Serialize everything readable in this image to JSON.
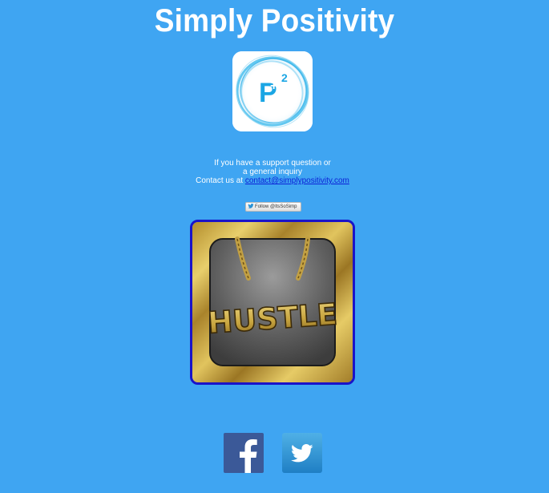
{
  "header": {
    "title": "Simply Positivity"
  },
  "logo": {
    "glyph": "P",
    "plus": "+",
    "superscript": "2",
    "accent_color": "#1ba6e4"
  },
  "support": {
    "line1": "If you have a support question or",
    "line2": "a general inquiry",
    "line3_prefix": "Contact us at",
    "email": "contact@simplypositivity.com",
    "email_href": "mailto:contact@simplypositivity.com"
  },
  "twitter_follow": {
    "label": "Follow @ItsSoSimp"
  },
  "app_image": {
    "text": "HUSTLE",
    "border_color": "#1a13c9"
  },
  "social": {
    "facebook_icon": "facebook-icon",
    "twitter_icon": "twitter-icon",
    "facebook_color": "#3b5998",
    "twitter_color": "#2a92d5"
  },
  "theme": {
    "background": "#3fa5f2",
    "text": "#ffffff",
    "link": "#0b1fd6"
  }
}
